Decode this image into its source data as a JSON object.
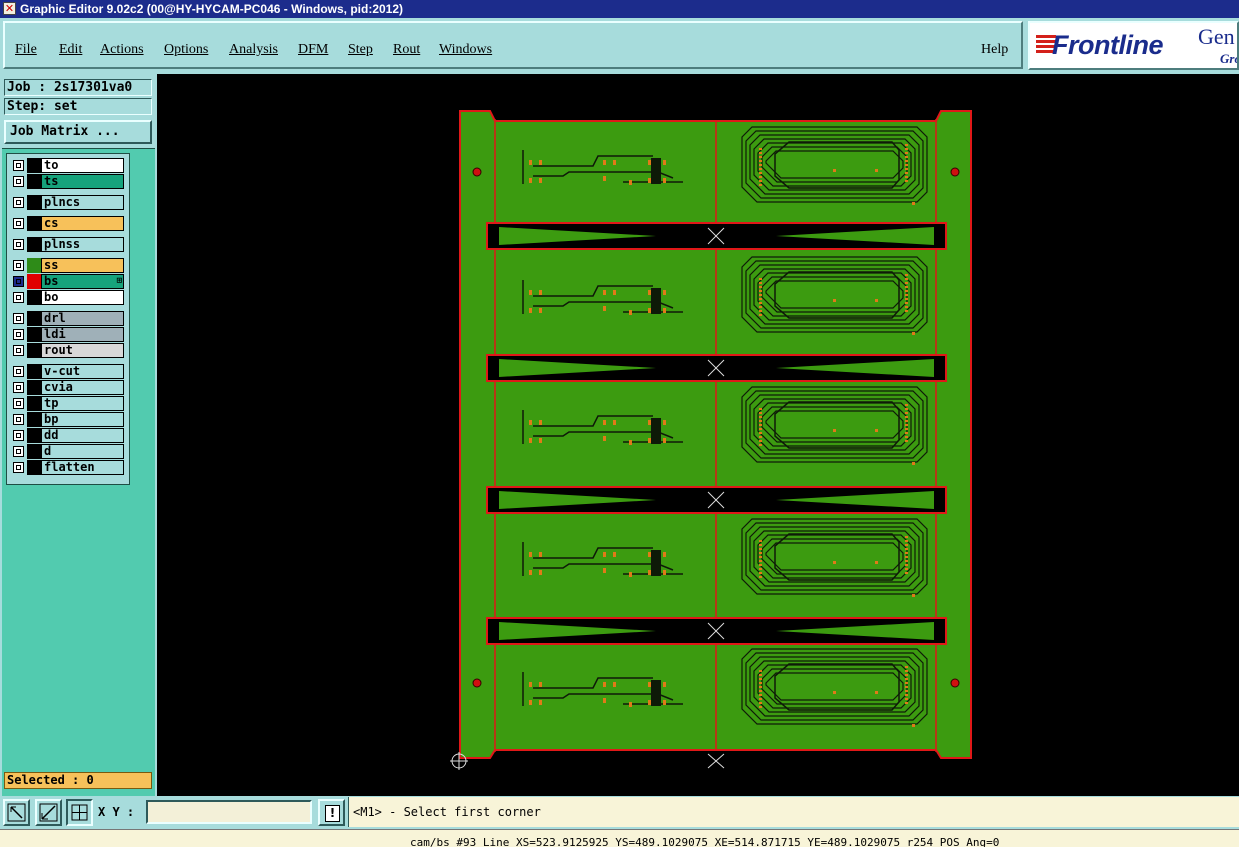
{
  "window": {
    "title": "Graphic Editor 9.02c2 (00@HY-HYCAM-PC046 - Windows, pid:2012)"
  },
  "menu": {
    "items": [
      "File",
      "Edit",
      "Actions",
      "Options",
      "Analysis",
      "DFM",
      "Step",
      "Rout",
      "Windows"
    ],
    "help": "Help"
  },
  "logo": {
    "brand": "Frontline",
    "suffix": "Gen",
    "tag": "Gro"
  },
  "job": {
    "job_line": "Job : 2s17301va0",
    "step_line": "Step: set",
    "matrix_button": "Job Matrix ..."
  },
  "layers": [
    {
      "name": "to",
      "color": "#ffffff",
      "swatch": "#000000"
    },
    {
      "name": "ts",
      "color": "#16a37c",
      "swatch": "#000000"
    },
    {
      "name": "plncs",
      "color": "#a7dcdc",
      "swatch": "#000000"
    },
    {
      "name": "cs",
      "color": "#f7c15a",
      "swatch": "#000000"
    },
    {
      "name": "plnss",
      "color": "#a7dcdc",
      "swatch": "#000000"
    },
    {
      "name": "ss",
      "color": "#f7c15a",
      "swatch": "#2e8b18"
    },
    {
      "name": "bs",
      "color": "#16a37c",
      "swatch": "#e00000"
    },
    {
      "name": "bo",
      "color": "#ffffff",
      "swatch": "#000000"
    },
    {
      "name": "drl",
      "color": "#9fb0b8",
      "swatch": "#000000"
    },
    {
      "name": "ldi",
      "color": "#9fb0b8",
      "swatch": "#000000"
    },
    {
      "name": "rout",
      "color": "#d8d8d8",
      "swatch": "#000000"
    },
    {
      "name": "v-cut",
      "color": "#a7dcdc",
      "swatch": "#000000"
    },
    {
      "name": "cvia",
      "color": "#a7dcdc",
      "swatch": "#000000"
    },
    {
      "name": "tp",
      "color": "#a7dcdc",
      "swatch": "#000000"
    },
    {
      "name": "bp",
      "color": "#a7dcdc",
      "swatch": "#000000"
    },
    {
      "name": "dd",
      "color": "#a7dcdc",
      "swatch": "#000000"
    },
    {
      "name": "d",
      "color": "#a7dcdc",
      "swatch": "#000000"
    },
    {
      "name": "flatten",
      "color": "#a7dcdc",
      "swatch": "#000000"
    }
  ],
  "layer_marker": "⊞",
  "selected": "Selected : 0",
  "toolbar": {
    "xy_label": "X Y :",
    "xy_value": "",
    "warn_label": "!",
    "prompt": "<M1> - Select first corner"
  },
  "status": "cam/bs #93 Line XS=523.9125925 YS=489.1029075 XE=514.871715 YE=489.1029075 r254 POS Ang=0",
  "board": {
    "copper": "#3c9b10",
    "outline": "#e01818",
    "trace": "#0e1a08",
    "pad": "#e07a18",
    "panels": 5
  }
}
